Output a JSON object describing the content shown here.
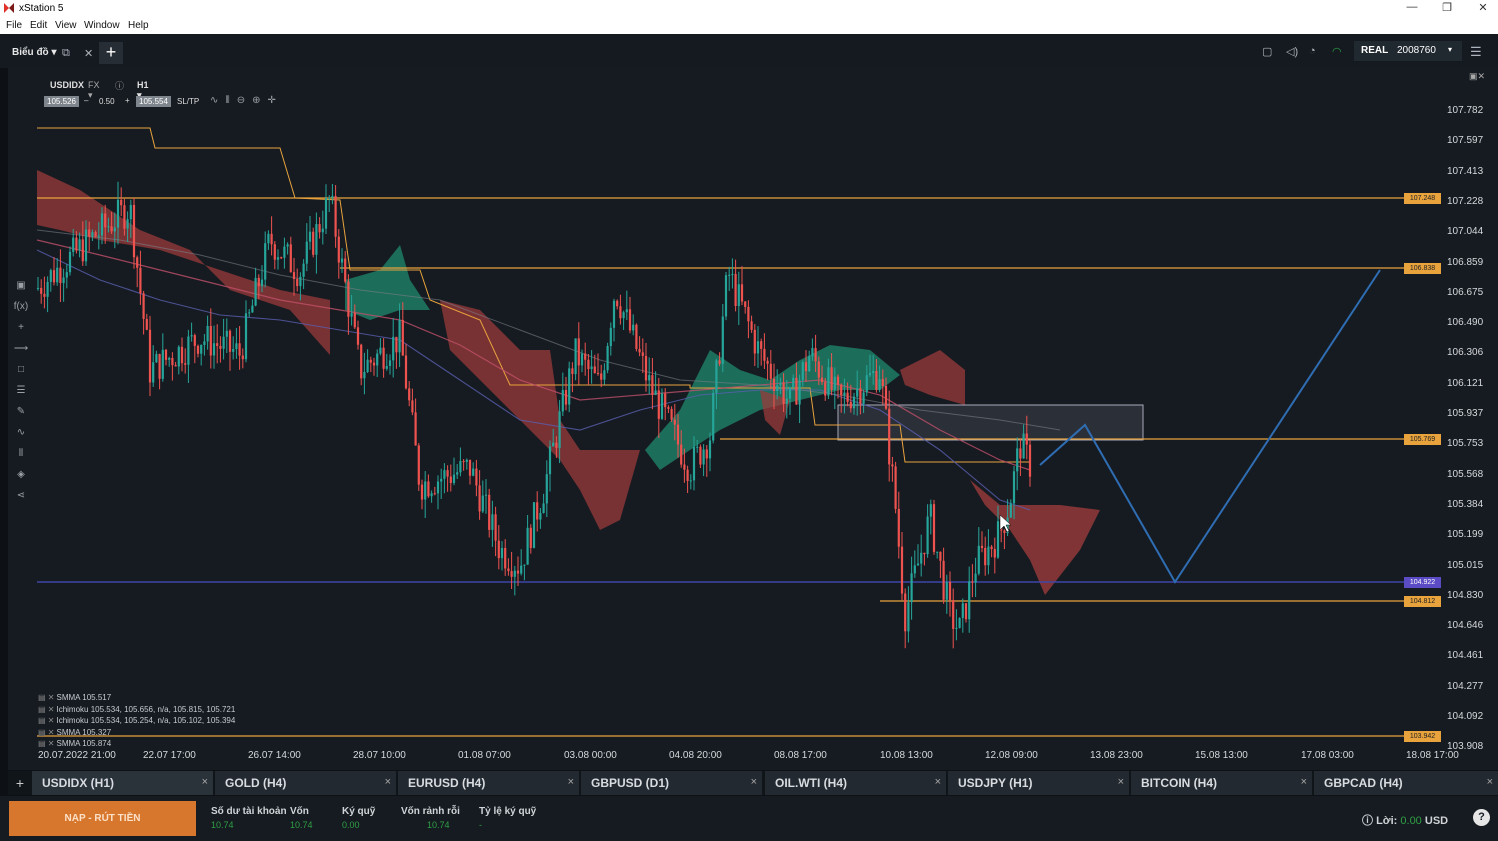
{
  "app": {
    "title": "xStation 5"
  },
  "window_controls": {
    "minimize": "—",
    "maximize": "❐",
    "close": "✕"
  },
  "menu": [
    "File",
    "Edit",
    "View",
    "Window",
    "Help"
  ],
  "toolbar": {
    "chart_tab": "Biểu đồ ▾",
    "add_tab": "+"
  },
  "account": {
    "mode": "REAL",
    "number": "2008760",
    "caret": "▾"
  },
  "chart": {
    "symbol": "USDIDX",
    "type": "FX ▾",
    "timeframe": "H1 ▾",
    "bid": "105.526",
    "lot": "0.50",
    "ask": "105.554",
    "sltp": "SL/TP",
    "minus": "–",
    "plus": "+"
  },
  "price_scale": [
    "107.782",
    "107.597",
    "107.413",
    "107.228",
    "107.044",
    "106.859",
    "106.675",
    "106.490",
    "106.306",
    "106.121",
    "105.937",
    "105.753",
    "105.568",
    "105.384",
    "105.199",
    "105.015",
    "104.830",
    "104.646",
    "104.461",
    "104.277",
    "104.092",
    "103.908"
  ],
  "price_tags": [
    {
      "text": "107.248",
      "color": "#e8a33d"
    },
    {
      "text": "106.838",
      "color": "#e8a33d"
    },
    {
      "text": "105.769",
      "color": "#e8a33d"
    },
    {
      "text": "104.922",
      "color": "#5b4bc4"
    },
    {
      "text": "104.812",
      "color": "#e8a33d"
    },
    {
      "text": "103.942",
      "color": "#e8a33d"
    }
  ],
  "time_axis": [
    "20.07.2022 21:00",
    "22.07 17:00",
    "26.07 14:00",
    "28.07 10:00",
    "01.08 07:00",
    "03.08 00:00",
    "04.08 20:00",
    "08.08 17:00",
    "10.08 13:00",
    "12.08 09:00",
    "13.08 23:00",
    "15.08 13:00",
    "17.08 03:00",
    "18.08 17:00"
  ],
  "indicators": [
    "SMMA 105.517",
    "Ichimoku 105.534, 105.656, n/a, 105.815, 105.721",
    "Ichimoku 105.534, 105.254, n/a, 105.102, 105.394",
    "SMMA 105.327",
    "SMMA 105.874"
  ],
  "tabs": [
    {
      "label": "USDIDX (H1)",
      "active": true
    },
    {
      "label": "GOLD (H4)"
    },
    {
      "label": "EURUSD (H4)"
    },
    {
      "label": "GBPUSD (D1)"
    },
    {
      "label": "OIL.WTI (H4)"
    },
    {
      "label": "USDJPY (H1)"
    },
    {
      "label": "BITCOIN (H4)"
    },
    {
      "label": "GBPCAD (H4)"
    }
  ],
  "tab_close": "×",
  "footer": {
    "deposit_button": "NẠP - RÚT TIỀN",
    "stats": [
      {
        "label": "Số dư tài khoản",
        "value": "10.74"
      },
      {
        "label": "Vốn",
        "value": "10.74"
      },
      {
        "label": "Ký quỹ",
        "value": "0.00"
      },
      {
        "label": "Vốn rảnh rỗi",
        "value": "10.74"
      },
      {
        "label": "Tỷ lệ ký quỹ",
        "value": "-"
      }
    ],
    "profit_label": "Lời:",
    "profit_value": "0.00",
    "currency": "USD",
    "help": "?"
  },
  "colors": {
    "bull": "#26a69a",
    "bear": "#ef5350",
    "cloud_bull": "#1f8a6e",
    "cloud_bear": "#9b3b3b",
    "level": "#e8a33d",
    "support": "#3d46a8",
    "projection": "#2f6db3"
  }
}
